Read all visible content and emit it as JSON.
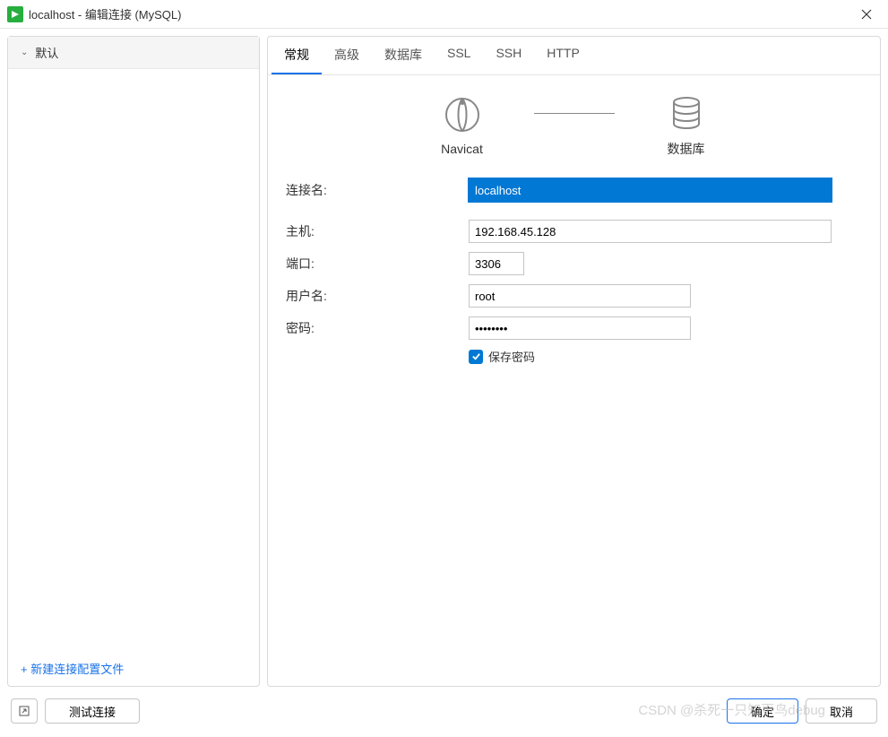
{
  "titlebar": {
    "title": "localhost - 编辑连接 (MySQL)"
  },
  "sidebar": {
    "default_item": "默认",
    "new_profile": "+ 新建连接配置文件"
  },
  "tabs": {
    "general": "常规",
    "advanced": "高级",
    "database": "数据库",
    "ssl": "SSL",
    "ssh": "SSH",
    "http": "HTTP"
  },
  "diagram": {
    "navicat": "Navicat",
    "database": "数据库"
  },
  "form": {
    "conn_name_label": "连接名:",
    "conn_name_value": "localhost",
    "host_label": "主机:",
    "host_value": "192.168.45.128",
    "port_label": "端口:",
    "port_value": "3306",
    "user_label": "用户名:",
    "user_value": "root",
    "password_label": "密码:",
    "password_value": "••••••••",
    "save_password": "保存密码"
  },
  "footer": {
    "test": "测试连接",
    "ok": "确定",
    "cancel": "取消"
  },
  "watermark": "CSDN @杀死一只知更鸟debug"
}
